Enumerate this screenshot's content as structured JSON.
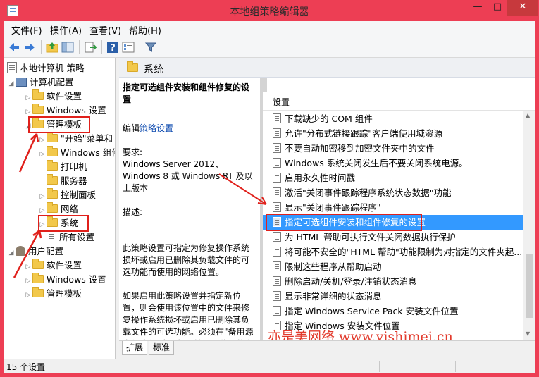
{
  "window": {
    "title": "本地组策略编辑器",
    "minimize": "—",
    "maximize": "□",
    "close": "✕"
  },
  "menu": [
    "文件(F)",
    "操作(A)",
    "查看(V)",
    "帮助(H)"
  ],
  "toolbar_icons": [
    "back-arrow-icon",
    "forward-arrow-icon",
    "up-folder-icon",
    "show-tree-icon",
    "export-list-icon",
    "help-icon",
    "properties-icon",
    "filter-icon"
  ],
  "tree": {
    "root": "本地计算机 策略",
    "computer_config": "计算机配置",
    "software_settings": "软件设置",
    "windows_settings": "Windows 设置",
    "admin_templates": "管理模板",
    "start_menu": "\"开始\"菜单和",
    "windows_components": "Windows 组件",
    "printers": "打印机",
    "server": "服务器",
    "control_panel": "控制面板",
    "network": "网络",
    "system": "系统",
    "all_settings": "所有设置",
    "user_config": "用户配置",
    "user_software_settings": "软件设置",
    "user_windows_settings": "Windows 设置",
    "user_admin_templates": "管理模板"
  },
  "pane_header": "系统",
  "description": {
    "title": "指定可选组件安装和组件修复的设置",
    "edit_prefix": "编辑",
    "edit_link": "策略设置",
    "requirements_label": "要求:",
    "requirements": "Windows Server 2012、Windows 8 或 Windows RT 及以上版本",
    "desc_label": "描述:",
    "para1": "此策略设置可指定为修复操作系统损坏或启用已删除其负载文件的可选功能而使用的网络位置。",
    "para2": "如果启用此策略设置并指定新位置，则会使用该位置中的文件来修复操作系统损坏或启用已删除其负载文件的可选功能。必须在\"备用源文件路径\"文本框中输入新位置的完全限定路径。可指定以分号分隔的"
  },
  "list": {
    "header": "设置",
    "items": [
      "下载缺少的 COM 组件",
      "允许\"分布式链接跟踪\"客户端使用域资源",
      "不要自动加密移到加密文件夹中的文件",
      "Windows 系统关闭发生后不要关闭系统电源。",
      "启用永久性时间戳",
      "激活\"关闭事件跟踪程序系统状态数据\"功能",
      "显示\"关闭事件跟踪程序\"",
      "指定可选组件安装和组件修复的设置",
      "为 HTML 帮助可执行文件关闭数据执行保护",
      "将可能不安全的\"HTML 帮助\"功能限制为对指定的文件夹起...",
      "限制这些程序从帮助启动",
      "删除启动/关机/登录/注销状态消息",
      "显示非常详细的状态消息",
      "指定 Windows Service Pack 安装文件位置",
      "指定 Windows 安装文件位置"
    ],
    "selected_index": 7
  },
  "watermark": "亦是美网络 www.yishimei.cn",
  "tabs": [
    "扩展",
    "标准"
  ],
  "status": "15 个设置",
  "colors": {
    "frame": "#ed3e54",
    "selection": "#3399ff",
    "highlight_box": "#e0201b",
    "link": "#0645ad"
  }
}
